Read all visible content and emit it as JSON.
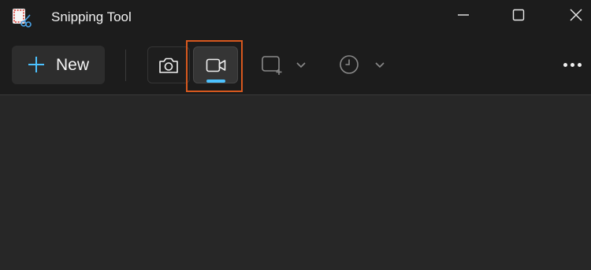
{
  "window": {
    "title": "Snipping Tool",
    "app_icon": "snipping-tool-icon",
    "controls": [
      "minimize-icon",
      "maximize-icon",
      "close-icon"
    ]
  },
  "toolbar": {
    "new_label": "New",
    "new_icon": "plus-icon",
    "modes": [
      {
        "name": "screenshot",
        "icon": "camera-icon",
        "selected": false
      },
      {
        "name": "record",
        "icon": "video-camera-icon",
        "selected": true
      }
    ],
    "snip_shape_icon": "rectangle-snip-icon",
    "delay_icon": "clock-icon",
    "more_icon": "more-options-icon"
  },
  "colors": {
    "accent": "#4cc2ff",
    "highlight_box": "#d7581e",
    "background": "#272727",
    "toolbar": "#1c1c1c"
  }
}
